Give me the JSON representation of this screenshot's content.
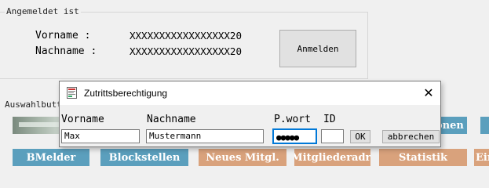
{
  "login_status": {
    "group_title": "Angemeldet ist",
    "vorname_label": "Vorname  :",
    "nachname_label": "Nachname  :",
    "vorname_value": "XXXXXXXXXXXXXXXXX20",
    "nachname_value": "XXXXXXXXXXXXXXXXX20",
    "login_button": "Anmelden"
  },
  "selection": {
    "group_title": "Auswahlbuttons",
    "tiles_row1_right": "Funktionen",
    "tiles_row2": [
      "BMelder",
      "Blockstellen",
      "Neues Mitgl.",
      "Mitgliederadr.",
      "Statistik",
      "Einstellungen"
    ]
  },
  "dialog": {
    "title": "Zutrittsberechtigung",
    "labels": {
      "vorname": "Vorname",
      "nachname": "Nachname",
      "passwort": "P.wort",
      "id": "ID"
    },
    "values": {
      "vorname": "Max",
      "nachname": "Mustermann",
      "passwort_mask": "●●●●●",
      "id": ""
    },
    "buttons": {
      "ok": "OK",
      "cancel": "abbrechen"
    },
    "close_glyph": "✕"
  },
  "colors": {
    "tile_blue": "#5b9fbd",
    "tile_orange": "#d9a27c",
    "focus": "#0078d7"
  }
}
